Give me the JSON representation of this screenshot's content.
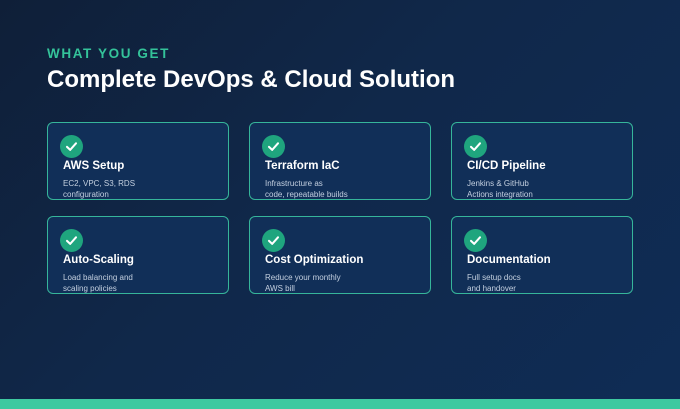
{
  "header": {
    "eyebrow": "WHAT YOU GET",
    "title": "Complete DevOps & Cloud Solution"
  },
  "colors": {
    "accent": "#34c39a",
    "card_border": "#36b59a",
    "card_bg": "#112f58",
    "check_bg": "#1fa57e",
    "bottom_bar": "#3ec9a0"
  },
  "cards": [
    {
      "icon": "check-circle-icon",
      "title": "AWS Setup",
      "desc": "EC2, VPC, S3, RDS\nconfiguration"
    },
    {
      "icon": "check-circle-icon",
      "title": "Terraform IaC",
      "desc": "Infrastructure as\ncode, repeatable builds"
    },
    {
      "icon": "check-circle-icon",
      "title": "CI/CD Pipeline",
      "desc": "Jenkins & GitHub\nActions integration"
    },
    {
      "icon": "check-circle-icon",
      "title": "Auto-Scaling",
      "desc": "Load balancing and\nscaling policies"
    },
    {
      "icon": "check-circle-icon",
      "title": "Cost Optimization",
      "desc": "Reduce your monthly\nAWS bill"
    },
    {
      "icon": "check-circle-icon",
      "title": "Documentation",
      "desc": "Full setup docs\nand handover"
    }
  ]
}
